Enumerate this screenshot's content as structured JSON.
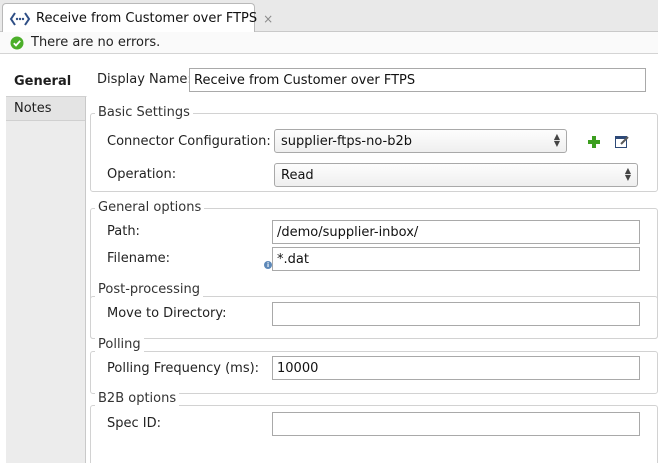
{
  "tab": {
    "title": "Receive from Customer over FTPS",
    "close": "×"
  },
  "status": {
    "text": "There are no errors."
  },
  "sidebar": {
    "items": [
      {
        "label": "General"
      },
      {
        "label": "Notes"
      }
    ]
  },
  "display_name": {
    "label": "Display Name:",
    "value": "Receive from Customer over FTPS"
  },
  "basic_settings": {
    "title": "Basic Settings",
    "connector_label": "Connector Configuration:",
    "connector_value": "supplier-ftps-no-b2b",
    "operation_label": "Operation:",
    "operation_value": "Read"
  },
  "general_options": {
    "title": "General options",
    "path_label": "Path:",
    "path_value": "/demo/supplier-inbox/",
    "filename_label": "Filename:",
    "filename_value": "*.dat"
  },
  "post_processing": {
    "title": "Post-processing",
    "move_label": "Move to Directory:",
    "move_value": ""
  },
  "polling": {
    "title": "Polling",
    "freq_label": "Polling Frequency (ms):",
    "freq_value": "10000"
  },
  "b2b_options": {
    "title": "B2B options",
    "spec_label": "Spec ID:",
    "spec_value": ""
  },
  "colors": {
    "ok_green": "#4caf2a",
    "add_green": "#3c9e1f",
    "info_blue": "#5d88b8"
  }
}
